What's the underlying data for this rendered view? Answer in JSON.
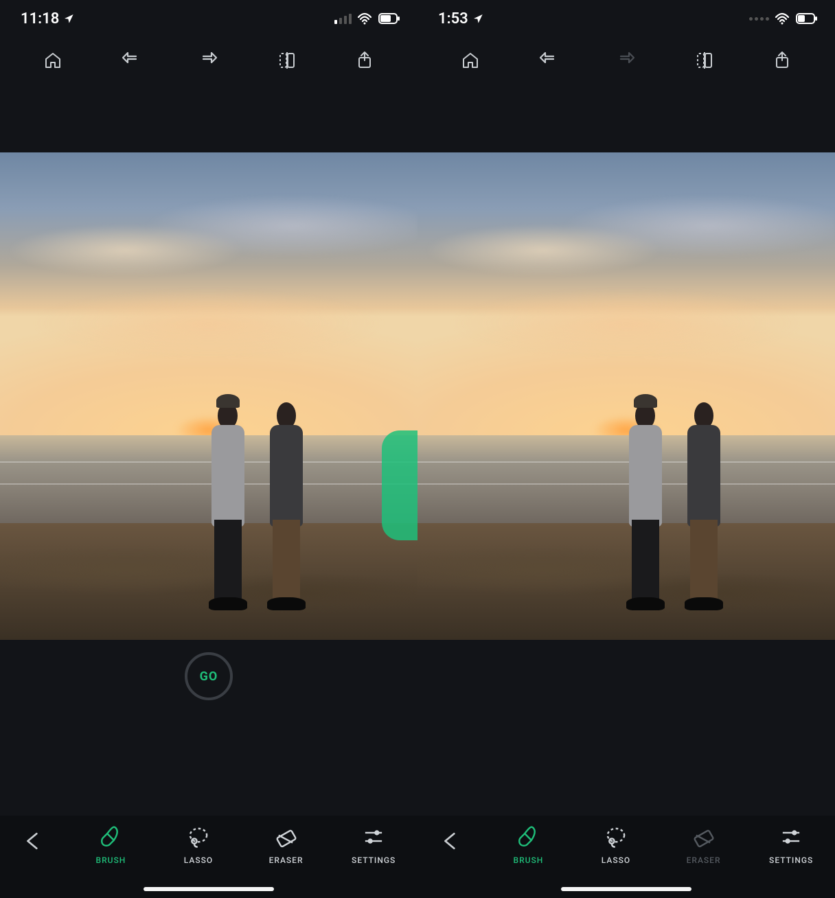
{
  "accent": "#1fbf7a",
  "screens": [
    {
      "status": {
        "time": "11:18",
        "signal": "weak-cellular"
      },
      "has_brush_mark": true,
      "has_go": true,
      "redo_enabled": true,
      "eraser_enabled": true
    },
    {
      "status": {
        "time": "1:53",
        "signal": "dots"
      },
      "has_brush_mark": false,
      "has_go": false,
      "redo_enabled": false,
      "eraser_enabled": false
    }
  ],
  "go_label": "GO",
  "tools": {
    "brush": "BRUSH",
    "lasso": "LASSO",
    "eraser": "ERASER",
    "settings": "SETTINGS"
  },
  "active_tool": "brush"
}
